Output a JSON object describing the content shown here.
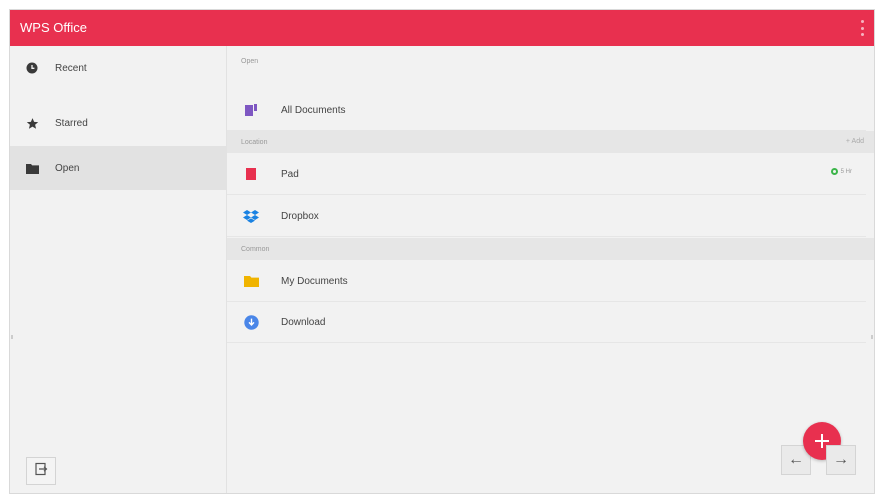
{
  "app": {
    "title": "WPS Office"
  },
  "sidebar": {
    "items": [
      {
        "label": "Recent",
        "icon": "clock-icon"
      },
      {
        "label": "Starred",
        "icon": "star-icon"
      },
      {
        "label": "Open",
        "icon": "folder-icon",
        "selected": true
      }
    ]
  },
  "main": {
    "sections": [
      {
        "title": "Open",
        "rows": [
          {
            "label": "All Documents",
            "icon": "documents-icon"
          }
        ]
      },
      {
        "title": "Location",
        "action": "+ Add",
        "rows": [
          {
            "label": "Pad",
            "icon": "pad-icon",
            "status": "5 Hr"
          },
          {
            "label": "Dropbox",
            "icon": "dropbox-icon"
          }
        ]
      },
      {
        "title": "Common",
        "rows": [
          {
            "label": "My Documents",
            "icon": "folder-icon"
          },
          {
            "label": "Download",
            "icon": "download-icon"
          }
        ]
      }
    ]
  },
  "nav": {
    "back": "←",
    "forward": "→"
  },
  "colors": {
    "accent": "#e8304f",
    "sync": "#3cb54a",
    "folder": "#f0b400",
    "download": "#4a86e8",
    "documents": "#7e57c2",
    "dropbox": "#1a82e2"
  }
}
